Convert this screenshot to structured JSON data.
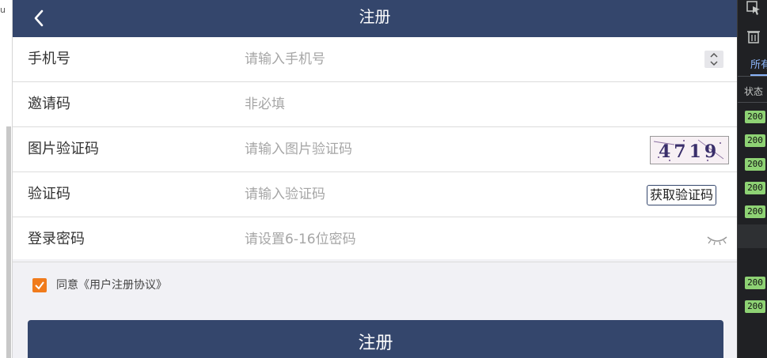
{
  "browser": {
    "left_fragment": "u"
  },
  "header": {
    "title": "注册"
  },
  "form": {
    "phone": {
      "label": "手机号",
      "placeholder": "请输入手机号"
    },
    "invite": {
      "label": "邀请码",
      "placeholder": "非必填"
    },
    "img_captcha": {
      "label": "图片验证码",
      "placeholder": "请输入图片验证码",
      "captcha_text": "4719"
    },
    "sms_code": {
      "label": "验证码",
      "placeholder": "请输入验证码",
      "get_code_label": "获取验证码"
    },
    "password": {
      "label": "登录密码",
      "placeholder": "请设置6-16位密码"
    }
  },
  "agreement": {
    "text": "同意《用户注册协议》",
    "checked": true,
    "check_color": "#f07b1c"
  },
  "submit": {
    "label": "注册"
  },
  "devtools": {
    "tab_label": "所有",
    "status_header": "状态",
    "status_codes": [
      "200",
      "200",
      "200",
      "200",
      "200",
      "200",
      "200"
    ]
  },
  "colors": {
    "primary": "#34466c",
    "accent": "#f07b1c",
    "status_ok": "#8ed274"
  }
}
